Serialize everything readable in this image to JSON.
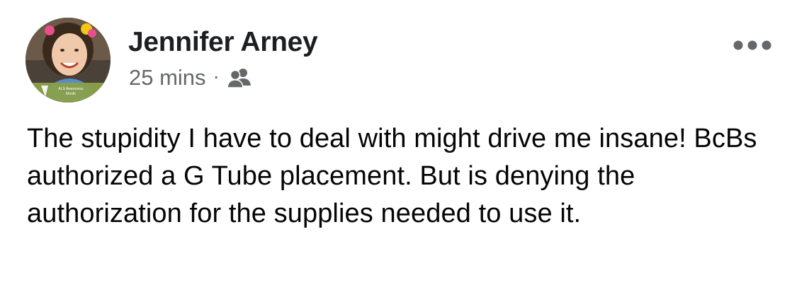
{
  "post": {
    "author": {
      "name": "Jennifer Arney",
      "avatar": {
        "icon": "profile-photo",
        "frame_text": "ALS Awareness Month"
      }
    },
    "meta": {
      "timestamp": "25 mins",
      "separator": "·",
      "audience_icon": "friends-icon"
    },
    "more_icon": "more-options-icon",
    "text": "The stupidity I have to deal with might drive me insane! BcBs authorized a G Tube placement. But is denying the authorization for the supplies needed to use it."
  },
  "colors": {
    "name": "#1c1e21",
    "meta": "#65676b",
    "body_text": "#050505",
    "avatar_frame": "#8aa04a"
  }
}
